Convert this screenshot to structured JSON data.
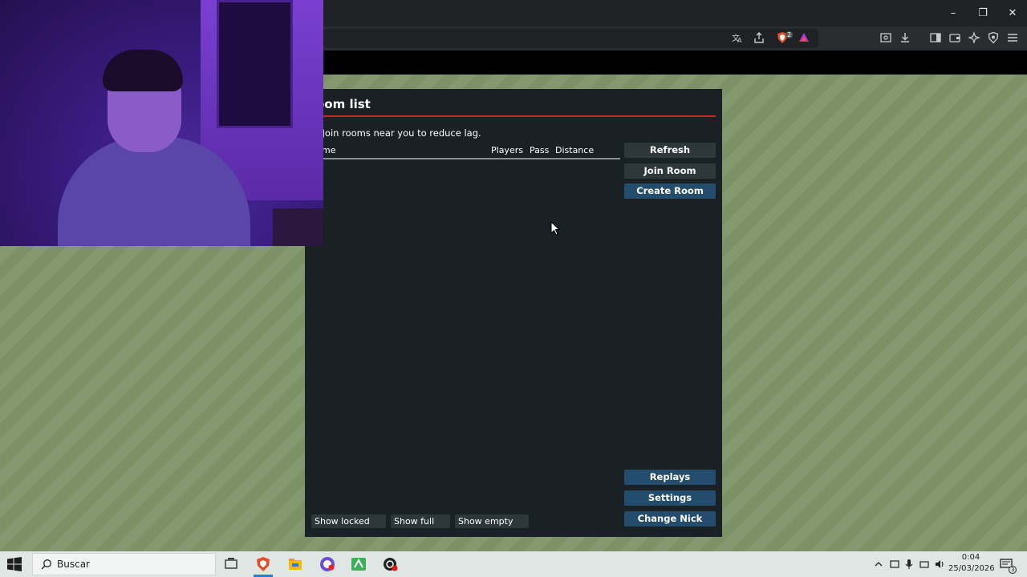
{
  "window": {
    "minimize": "–",
    "restore": "❐",
    "close": "✕"
  },
  "toolbar_icons": [
    "translate-icon",
    "share-icon",
    "brave-shields-icon",
    "rewards-icon",
    "screenshot-icon",
    "download-icon",
    "sidebar-icon",
    "wallet-icon",
    "leo-ai-icon",
    "vpn-icon",
    "menu-icon"
  ],
  "shields_badge": "2",
  "dialog": {
    "title": "oom list",
    "tip": ": Join rooms near you to reduce lag.",
    "columns": {
      "name": "me",
      "players": "Players",
      "pass": "Pass",
      "distance": "Distance"
    },
    "buttons": {
      "refresh": "Refresh",
      "join_room": "Join Room",
      "create_room": "Create Room",
      "replays": "Replays",
      "settings": "Settings",
      "change_nick": "Change Nick"
    },
    "toggles": {
      "show_locked": "Show locked",
      "show_full": "Show full",
      "show_empty": "Show empty"
    },
    "rooms": []
  },
  "taskbar": {
    "search_label": "Buscar",
    "clock_time": "0:04",
    "clock_date": "25/03/2026",
    "notification_count": "3"
  },
  "colors": {
    "accent_rule": "#c2272d",
    "button_blue": "#244c6d",
    "button_gray": "#2d373c",
    "dialog_bg": "#1a2125",
    "field": "#7f9468"
  }
}
